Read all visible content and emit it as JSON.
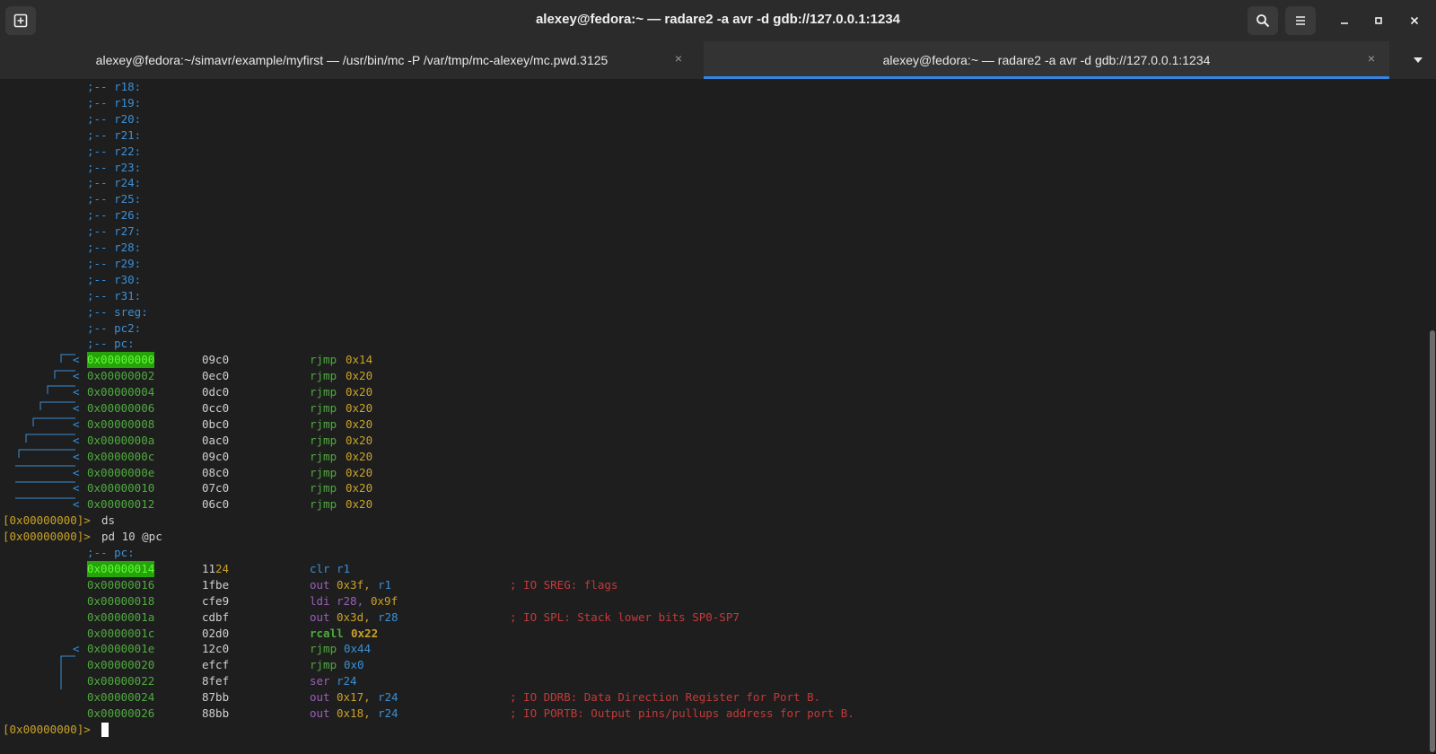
{
  "window": {
    "title": "alexey@fedora:~ — radare2 -a avr -d gdb://127.0.0.1:1234",
    "new_tab_icon": "new-tab-icon",
    "search_icon": "search-icon",
    "menu_icon": "hamburger-menu-icon"
  },
  "tabs": [
    {
      "label": "alexey@fedora:~/simavr/example/myfirst — /usr/bin/mc -P /var/tmp/mc-alexey/mc.pwd.3125",
      "active": false
    },
    {
      "label": "alexey@fedora:~ — radare2 -a avr -d gdb://127.0.0.1:1234",
      "active": true
    }
  ],
  "tab_close_glyph": "×",
  "colors": {
    "accent": "#3584e4",
    "address": "#4eab3d",
    "comment": "#c33a3a",
    "highlight": "#26a20a"
  },
  "terminal": {
    "flags": [
      ";-- r18:",
      ";-- r19:",
      ";-- r20:",
      ";-- r21:",
      ";-- r22:",
      ";-- r23:",
      ";-- r24:",
      ";-- r25:",
      ";-- r26:",
      ";-- r27:",
      ";-- r28:",
      ";-- r29:",
      ";-- r30:",
      ";-- r31:",
      ";-- sreg:",
      ";-- pc2:",
      ";-- pc:"
    ],
    "vector_table": [
      {
        "addr": "0x00000000",
        "bytes": "09c0",
        "op": "rjmp",
        "arg": "0x14",
        "hl": true
      },
      {
        "addr": "0x00000002",
        "bytes": "0ec0",
        "op": "rjmp",
        "arg": "0x20"
      },
      {
        "addr": "0x00000004",
        "bytes": "0dc0",
        "op": "rjmp",
        "arg": "0x20"
      },
      {
        "addr": "0x00000006",
        "bytes": "0cc0",
        "op": "rjmp",
        "arg": "0x20"
      },
      {
        "addr": "0x00000008",
        "bytes": "0bc0",
        "op": "rjmp",
        "arg": "0x20"
      },
      {
        "addr": "0x0000000a",
        "bytes": "0ac0",
        "op": "rjmp",
        "arg": "0x20"
      },
      {
        "addr": "0x0000000c",
        "bytes": "09c0",
        "op": "rjmp",
        "arg": "0x20"
      },
      {
        "addr": "0x0000000e",
        "bytes": "08c0",
        "op": "rjmp",
        "arg": "0x20"
      },
      {
        "addr": "0x00000010",
        "bytes": "07c0",
        "op": "rjmp",
        "arg": "0x20"
      },
      {
        "addr": "0x00000012",
        "bytes": "06c0",
        "op": "rjmp",
        "arg": "0x20"
      }
    ],
    "prompt": "[0x00000000]>",
    "cmd1": "ds",
    "cmd2": "pd 10 @pc",
    "pc_flag": ";-- pc:",
    "listing": [
      {
        "addr": "0x00000014",
        "bytes": "11",
        "bytes_hi": "24",
        "op": "clr",
        "a1": "r1",
        "a2": "",
        "comment": "",
        "hl": true
      },
      {
        "addr": "0x00000016",
        "bytes": "1fbe",
        "op": "out",
        "a1": "0x3f,",
        "a2": "r1",
        "comment": "; IO SREG: flags"
      },
      {
        "addr": "0x00000018",
        "bytes": "cfe9",
        "op": "ldi",
        "a1": "r28,",
        "a2": "0x9f",
        "comment": ""
      },
      {
        "addr": "0x0000001a",
        "bytes": "cdbf",
        "op": "out",
        "a1": "0x3d,",
        "a2": "r28",
        "comment": "; IO SPL: Stack lower bits SP0-SP7"
      },
      {
        "addr": "0x0000001c",
        "bytes": "02d0",
        "op": "rcall",
        "a1": "0x22",
        "a2": "",
        "comment": ""
      },
      {
        "addr": "0x0000001e",
        "bytes": "12c0",
        "op": "rjmp",
        "a1": "0x44",
        "a2": "",
        "comment": ""
      },
      {
        "addr": "0x00000020",
        "bytes": "efcf",
        "op": "rjmp",
        "a1": "0x0",
        "a2": "",
        "comment": ""
      },
      {
        "addr": "0x00000022",
        "bytes": "8fef",
        "op": "ser",
        "a1": "r24",
        "a2": "",
        "comment": ""
      },
      {
        "addr": "0x00000024",
        "bytes": "87bb",
        "op": "out",
        "a1": "0x17,",
        "a2": "r24",
        "comment": "; IO DDRB: Data Direction Register for Port B."
      },
      {
        "addr": "0x00000026",
        "bytes": "88bb",
        "op": "out",
        "a1": "0x18,",
        "a2": "r24",
        "comment": "; IO PORTB: Output pins/pullups address for port B."
      }
    ]
  }
}
